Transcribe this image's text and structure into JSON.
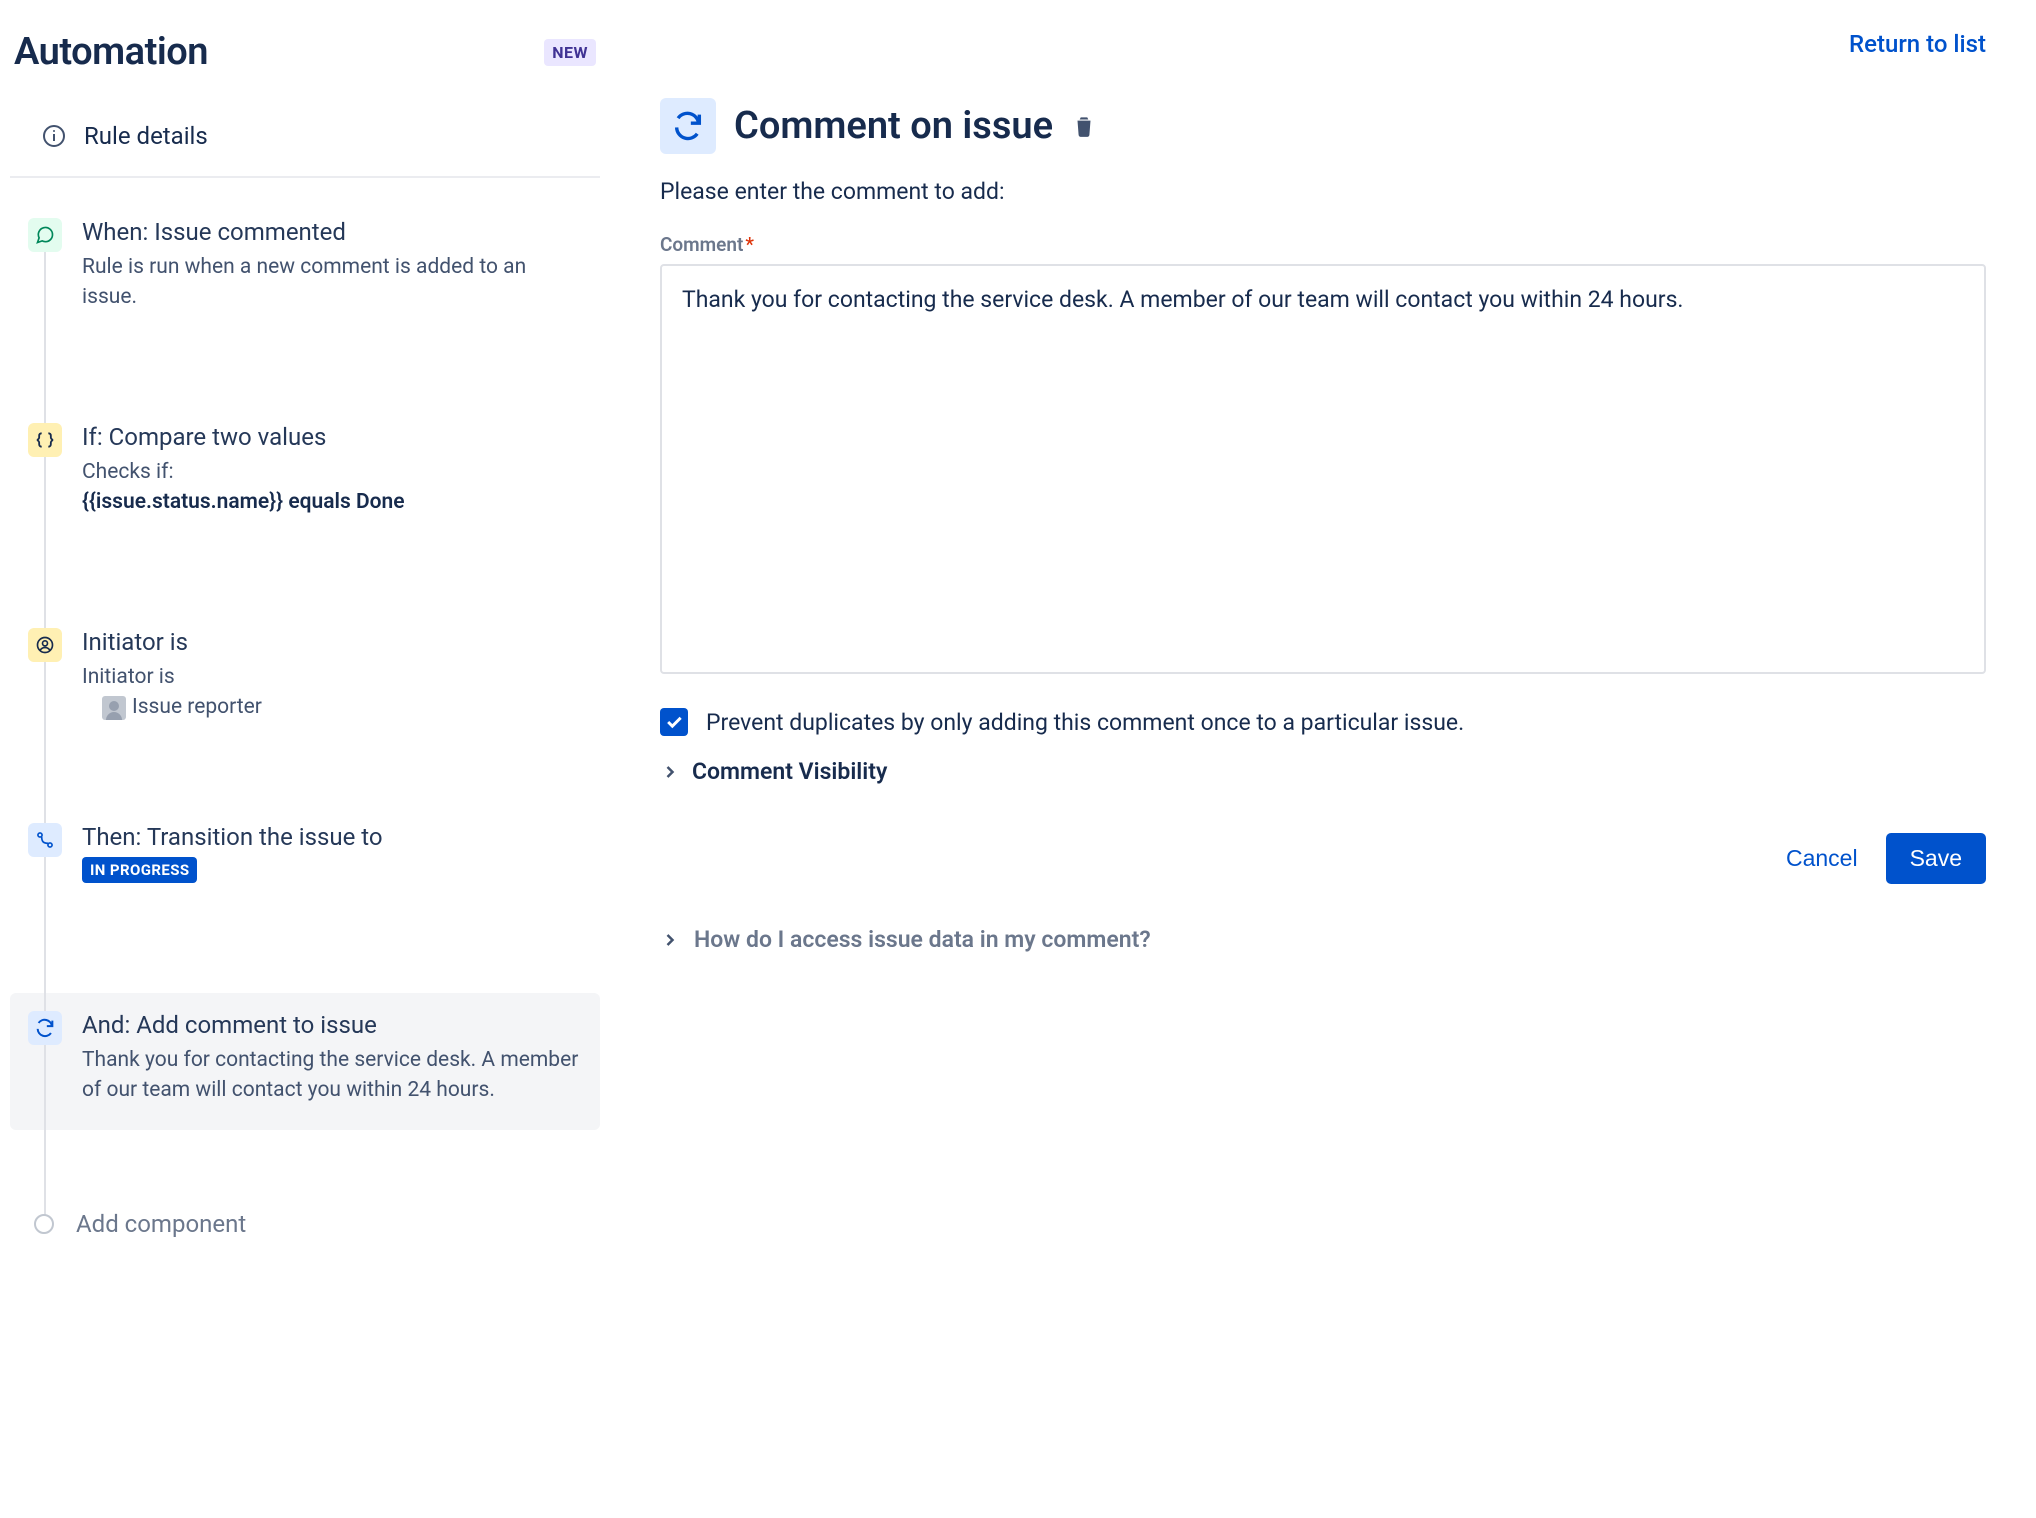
{
  "header": {
    "title": "Automation",
    "new_badge": "NEW",
    "return_link": "Return to list"
  },
  "sidebar": {
    "rule_details": "Rule details",
    "steps": {
      "trigger": {
        "title": "When: Issue commented",
        "desc": "Rule is run when a new comment is added to an issue."
      },
      "condition1": {
        "title": "If: Compare two values",
        "desc_lead": "Checks if:",
        "desc_bold": "{{issue.status.name}} equals Done"
      },
      "condition2": {
        "title": "Initiator is",
        "desc_lead": "Initiator is",
        "desc_value": "Issue reporter"
      },
      "action1": {
        "title": "Then: Transition the issue to",
        "lozenge": "IN PROGRESS"
      },
      "action2": {
        "title": "And: Add comment to issue",
        "desc": "Thank you for contacting the service desk. A member of our team will contact you within 24 hours."
      }
    },
    "add_component": "Add component"
  },
  "main": {
    "title": "Comment on issue",
    "intro": "Please enter the comment to add:",
    "comment_label": "Comment",
    "comment_value": "Thank you for contacting the service desk. A member of our team will contact you within 24 hours.",
    "prevent_duplicates_checked": true,
    "prevent_duplicates_label": "Prevent duplicates by only adding this comment once to a particular issue.",
    "visibility_label": "Comment Visibility",
    "cancel": "Cancel",
    "save": "Save",
    "help": "How do I access issue data in my comment?"
  }
}
